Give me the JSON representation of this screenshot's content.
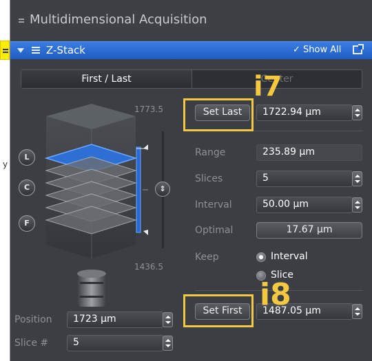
{
  "left_margin": {
    "char": "y"
  },
  "panel": {
    "title": "Multidimensional Acquisition"
  },
  "zstack_bar": {
    "title": "Z-Stack",
    "show_all": "✓ Show All"
  },
  "tabs": [
    {
      "label": "First / Last",
      "active": true
    },
    {
      "label": "Center",
      "active": false
    }
  ],
  "stack_visual": {
    "top_value": "1773.5",
    "bottom_value": "1436.5",
    "buttons": {
      "last": "L",
      "center": "C",
      "first": "F"
    }
  },
  "set_last": {
    "label": "Set Last",
    "value": "1722.94 µm"
  },
  "set_first": {
    "label": "Set First",
    "value": "1487.05 µm"
  },
  "params": {
    "range_label": "Range",
    "range_value": "235.89 µm",
    "slices_label": "Slices",
    "slices_value": "5",
    "interval_label": "Interval",
    "interval_value": "50.00 µm",
    "optimal_label": "Optimal",
    "optimal_value": "17.67 µm",
    "keep_label": "Keep",
    "keep_options": [
      {
        "label": "Interval",
        "selected": true
      },
      {
        "label": "Slice",
        "selected": false
      }
    ]
  },
  "position": {
    "label": "Position",
    "value": "1723 µm"
  },
  "slice_num": {
    "label": "Slice #",
    "value": "5"
  },
  "annotations": {
    "i7": "i7",
    "i8": "i8",
    "highlight_color": "#f5c842"
  },
  "colors": {
    "panel_bg": "#3b3f44",
    "accent_blue": "#2a68d4"
  }
}
